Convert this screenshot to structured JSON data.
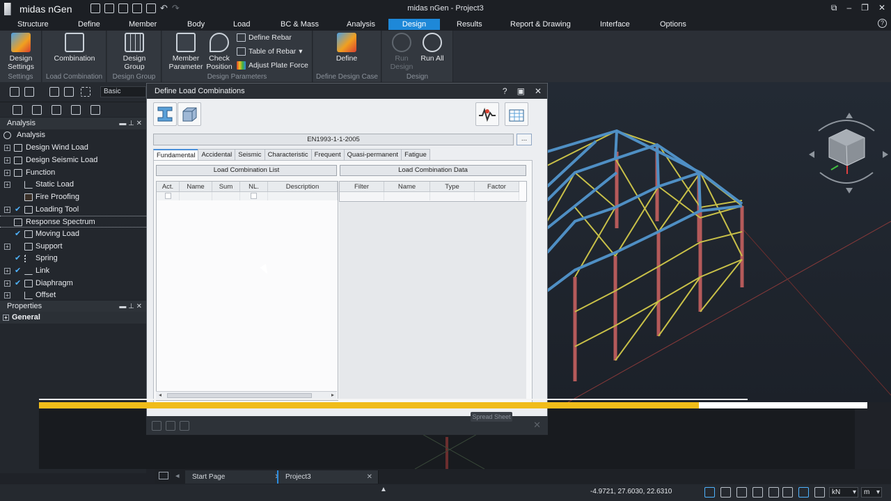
{
  "app": {
    "logo_text": "midas nGen",
    "window_title": "midas nGen - Project3"
  },
  "menu": [
    "Structure",
    "Define",
    "Member",
    "Body",
    "Load",
    "BC & Mass",
    "Analysis",
    "Design",
    "Results",
    "Report & Drawing",
    "Interface",
    "Options"
  ],
  "menu_active": "Design",
  "ribbon": {
    "design_settings": "Design Settings",
    "settings_group": "Settings",
    "combination": "Combination",
    "load_combination_group": "Load Combination",
    "design_group_btn": "Design Group",
    "design_group_group": "Design Group",
    "member_parameter": "Member Parameter",
    "check_position": "Check Position",
    "define_rebar": "Define Rebar",
    "table_of_rebar": "Table of Rebar",
    "adjust_plate_force": "Adjust Plate Force",
    "design_parameters_group": "Design Parameters",
    "define": "Define",
    "define_design_case_group": "Define Design Case",
    "run_design": "Run Design",
    "run_all": "Run All",
    "design_group": "Design"
  },
  "toolbar": {
    "view_mode": "Basic"
  },
  "analysis_panel": {
    "title": "Analysis",
    "root": "Analysis",
    "items": [
      {
        "label": "Design Wind Load",
        "check": false
      },
      {
        "label": "Design Seismic Load",
        "check": false
      },
      {
        "label": "Function",
        "check": false
      },
      {
        "label": "Static Load",
        "check": false
      },
      {
        "label": "Fire Proofing",
        "check": false
      },
      {
        "label": "Loading Tool",
        "check": true
      },
      {
        "label": "Response Spectrum",
        "check": false
      },
      {
        "label": "Moving Load",
        "check": true
      },
      {
        "label": "Support",
        "check": false
      },
      {
        "label": "Spring",
        "check": true
      },
      {
        "label": "Link",
        "check": true
      },
      {
        "label": "Diaphragm",
        "check": true
      },
      {
        "label": "Offset",
        "check": false
      }
    ]
  },
  "properties_panel": {
    "title": "Properties",
    "general": "General"
  },
  "dialog": {
    "title": "Define Load Combinations",
    "standard": "EN1993-1-1-2005",
    "browse": "...",
    "tabs": [
      "Fundamental",
      "Accidental",
      "Seismic",
      "Characteristic",
      "Frequent",
      "Quasi-permanent",
      "Fatigue"
    ],
    "active_tab": "Fundamental",
    "list_title": "Load Combination List",
    "list_columns": [
      "Act.",
      "Name",
      "Sum",
      "NL.",
      "Description"
    ],
    "data_title": "Load Combination Data",
    "data_columns": [
      "Filter",
      "Name",
      "Type",
      "Factor"
    ],
    "spread_sheet": "Spread Sheet"
  },
  "doc_tabs": [
    {
      "label": "Start Page",
      "active": false
    },
    {
      "label": "Project3",
      "active": true
    }
  ],
  "status": {
    "coords": "-4.9721, 27.6030, 22.6310",
    "force_unit": "kN",
    "length_unit": "m"
  },
  "progress": {
    "fraction": 0.797
  },
  "colors": {
    "accent": "#1e88d8",
    "progress": "#f0bc1a",
    "beam_blue": "#4f8fc4",
    "brace_yellow": "#c9c24a",
    "column_red": "#b65a5a"
  }
}
